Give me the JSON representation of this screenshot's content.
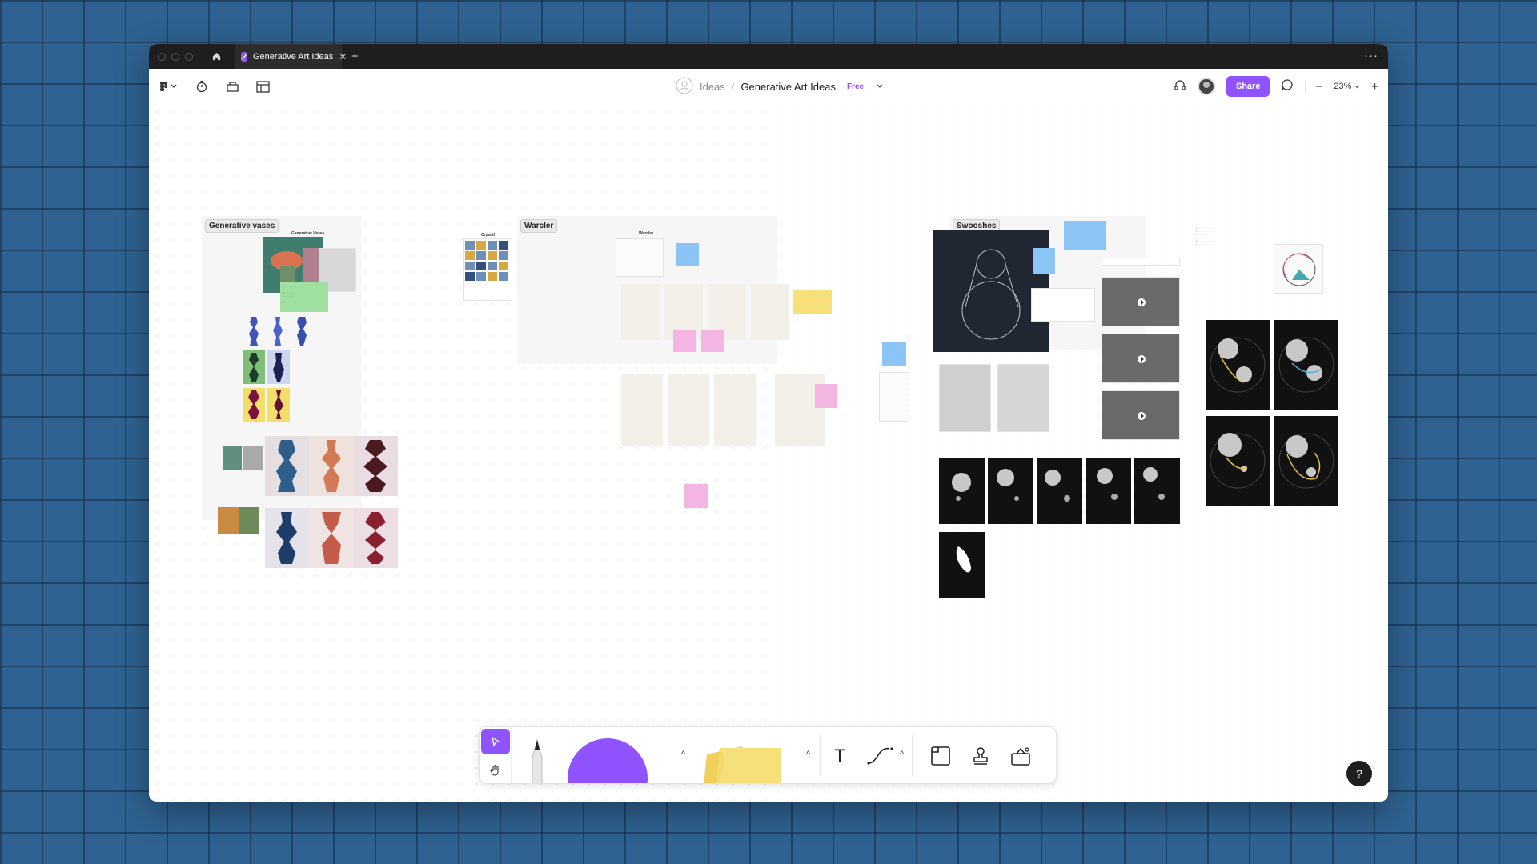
{
  "tabbar": {
    "tab_title": "Generative Art Ideas",
    "close_glyph": "✕",
    "add_glyph": "+",
    "more_glyph": "···"
  },
  "header": {
    "team": "Ideas",
    "separator": "/",
    "file_name": "Generative Art Ideas",
    "plan_badge": "Free",
    "share_label": "Share",
    "zoom_level": "23%",
    "zoom_minus": "−",
    "zoom_plus": "+"
  },
  "icons": {
    "tab": "figjam-icon",
    "home": "home-icon",
    "menu": "figjam-menu-icon",
    "timer": "timer-icon",
    "library": "library-icon",
    "layout": "layout-icon",
    "audio": "headphones-icon",
    "comment": "comment-icon",
    "help": "help-icon"
  },
  "sections": {
    "vases": "Generative vases",
    "vases_sub": "Generative Vases",
    "crystal": "Crystal",
    "warcler": "Warcler",
    "warcler_sub": "Warcler",
    "swooshes": "Swooshes"
  },
  "toolbar": {
    "text_glyph": "T",
    "caret": "^"
  },
  "help_label": "?",
  "colors": {
    "accent": "#8f54ff",
    "sticky_blue": "#8cc4f5",
    "sticky_green": "#9fe0a0",
    "sticky_yellow": "#f7e07a",
    "sticky_pink": "#f3b6e3",
    "background": "#2f6290"
  }
}
